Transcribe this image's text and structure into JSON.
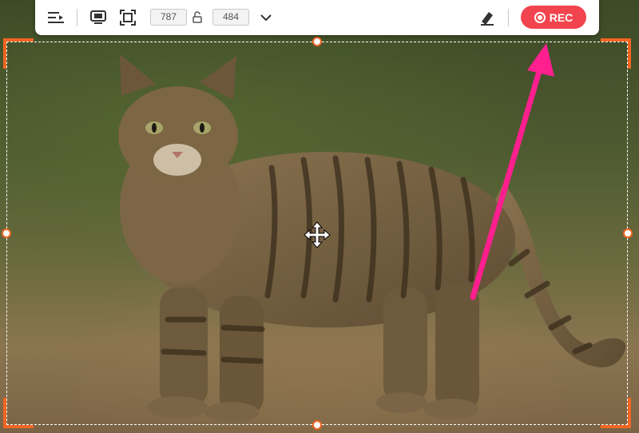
{
  "toolbar": {
    "width_value": "787",
    "height_value": "484",
    "rec_label": "REC",
    "icons": [
      "menu-collapse-icon",
      "fullscreen-icon",
      "region-select-icon",
      "aspect-lock-icon",
      "chevron-down-icon",
      "eraser-pen-icon",
      "record-icon"
    ]
  },
  "capture": {
    "accent_color": "#f26522"
  },
  "annotation": {
    "arrow_color": "#ff1f8e"
  }
}
